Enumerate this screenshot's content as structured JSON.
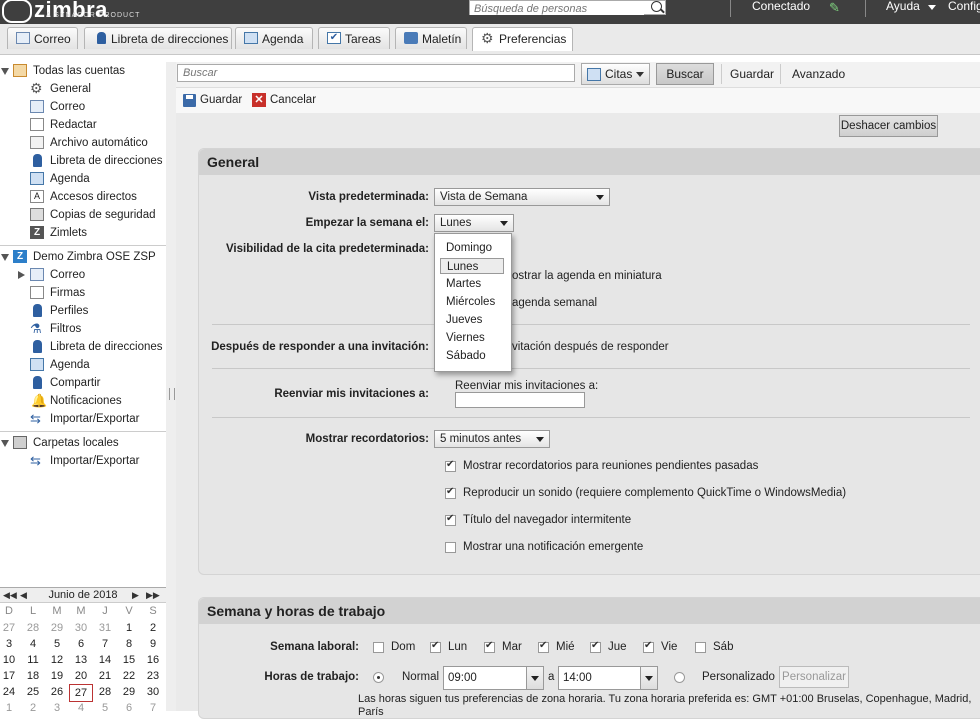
{
  "header": {
    "logo": "zimbra",
    "logo_sub": "A SYNACOR PRODUCT",
    "people_search_placeholder": "Búsqueda de personas",
    "status": "Conectado",
    "help": "Ayuda",
    "config": "Config"
  },
  "tabs": [
    {
      "label": "Correo",
      "icon": "mail-icon"
    },
    {
      "label": "Libreta de direcciones",
      "icon": "contacts-icon"
    },
    {
      "label": "Agenda",
      "icon": "calendar-icon"
    },
    {
      "label": "Tareas",
      "icon": "tasks-icon"
    },
    {
      "label": "Maletín",
      "icon": "briefcase-icon"
    },
    {
      "label": "Preferencias",
      "icon": "gear-icon",
      "active": true
    }
  ],
  "sidebar": {
    "all_accounts": {
      "label": "Todas las cuentas",
      "items": [
        "General",
        "Correo",
        "Redactar",
        "Archivo automático",
        "Libreta de direcciones",
        "Agenda",
        "Accesos directos",
        "Copias de seguridad",
        "Zimlets"
      ]
    },
    "demo_account": {
      "label": "Demo Zimbra OSE ZSP",
      "items": [
        "Correo",
        "Firmas",
        "Perfiles",
        "Filtros",
        "Libreta de direcciones",
        "Agenda",
        "Compartir",
        "Notificaciones",
        "Importar/Exportar"
      ]
    },
    "local_folders": {
      "label": "Carpetas locales",
      "items": [
        "Importar/Exportar"
      ]
    }
  },
  "minical": {
    "month_label": "Junio de 2018",
    "nav": {
      "prev_year": "◀◀",
      "prev": "◀",
      "next": "▶",
      "next_year": "▶▶"
    },
    "dow": [
      "D",
      "L",
      "M",
      "M",
      "J",
      "V",
      "S"
    ],
    "weeks": [
      [
        "27",
        "28",
        "29",
        "30",
        "31",
        "1",
        "2"
      ],
      [
        "3",
        "4",
        "5",
        "6",
        "7",
        "8",
        "9"
      ],
      [
        "10",
        "11",
        "12",
        "13",
        "14",
        "15",
        "16"
      ],
      [
        "17",
        "18",
        "19",
        "20",
        "21",
        "22",
        "23"
      ],
      [
        "24",
        "25",
        "26",
        "27",
        "28",
        "29",
        "30"
      ],
      [
        "1",
        "2",
        "3",
        "4",
        "5",
        "6",
        "7"
      ]
    ],
    "today": "27"
  },
  "searchbar": {
    "placeholder": "Buscar",
    "type": "Citas",
    "search_btn": "Buscar",
    "save_btn": "Guardar",
    "advanced_btn": "Avanzado"
  },
  "actions": {
    "save": "Guardar",
    "cancel": "Cancelar",
    "undo": "Deshacer cambios"
  },
  "general": {
    "title": "General",
    "default_view_label": "Vista predeterminada:",
    "default_view_value": "Vista de Semana",
    "week_start_label": "Empezar la semana el:",
    "week_start_value": "Lunes",
    "visibility_label": "Visibilidad de la cita predeterminada:",
    "mini_cal_text": "ostrar la agenda en miniatura",
    "week_agenda_text": "agenda semanal",
    "after_reply_label": "Después de responder a una invitación:",
    "after_reply_text": "vitación después de responder",
    "forward_label": "Reenviar mis invitaciones a:",
    "forward_sublabel": "Reenviar mis invitaciones a:",
    "forward_value": "",
    "reminders_label": "Mostrar recordatorios:",
    "reminders_value": "5 minutos antes",
    "checks": [
      {
        "label": "Mostrar recordatorios para reuniones pendientes pasadas",
        "checked": true
      },
      {
        "label": "Reproducir un sonido (requiere complemento QuickTime o WindowsMedia)",
        "checked": true
      },
      {
        "label": "Título del navegador intermitente",
        "checked": true
      },
      {
        "label": "Mostrar una notificación emergente",
        "checked": false
      }
    ]
  },
  "week_popup": {
    "options": [
      "Domingo",
      "Lunes",
      "Martes",
      "Miércoles",
      "Jueves",
      "Viernes",
      "Sábado"
    ],
    "selected": "Lunes"
  },
  "workweek": {
    "title": "Semana y horas de trabajo",
    "days_label": "Semana laboral:",
    "days": [
      {
        "label": "Dom",
        "checked": false
      },
      {
        "label": "Lun",
        "checked": true
      },
      {
        "label": "Mar",
        "checked": true
      },
      {
        "label": "Mié",
        "checked": true
      },
      {
        "label": "Jue",
        "checked": true
      },
      {
        "label": "Vie",
        "checked": true
      },
      {
        "label": "Sáb",
        "checked": false
      }
    ],
    "hours_label": "Horas de trabajo:",
    "normal_label": "Normal",
    "from": "09:00",
    "to_sep": "a",
    "to": "14:00",
    "custom_label": "Personalizado",
    "customize_btn": "Personalizar",
    "tz_note": "Las horas siguen tus preferencias de zona horaria. Tu zona horaria preferida es: GMT +01:00 Bruselas, Copenhague, Madrid, París"
  }
}
